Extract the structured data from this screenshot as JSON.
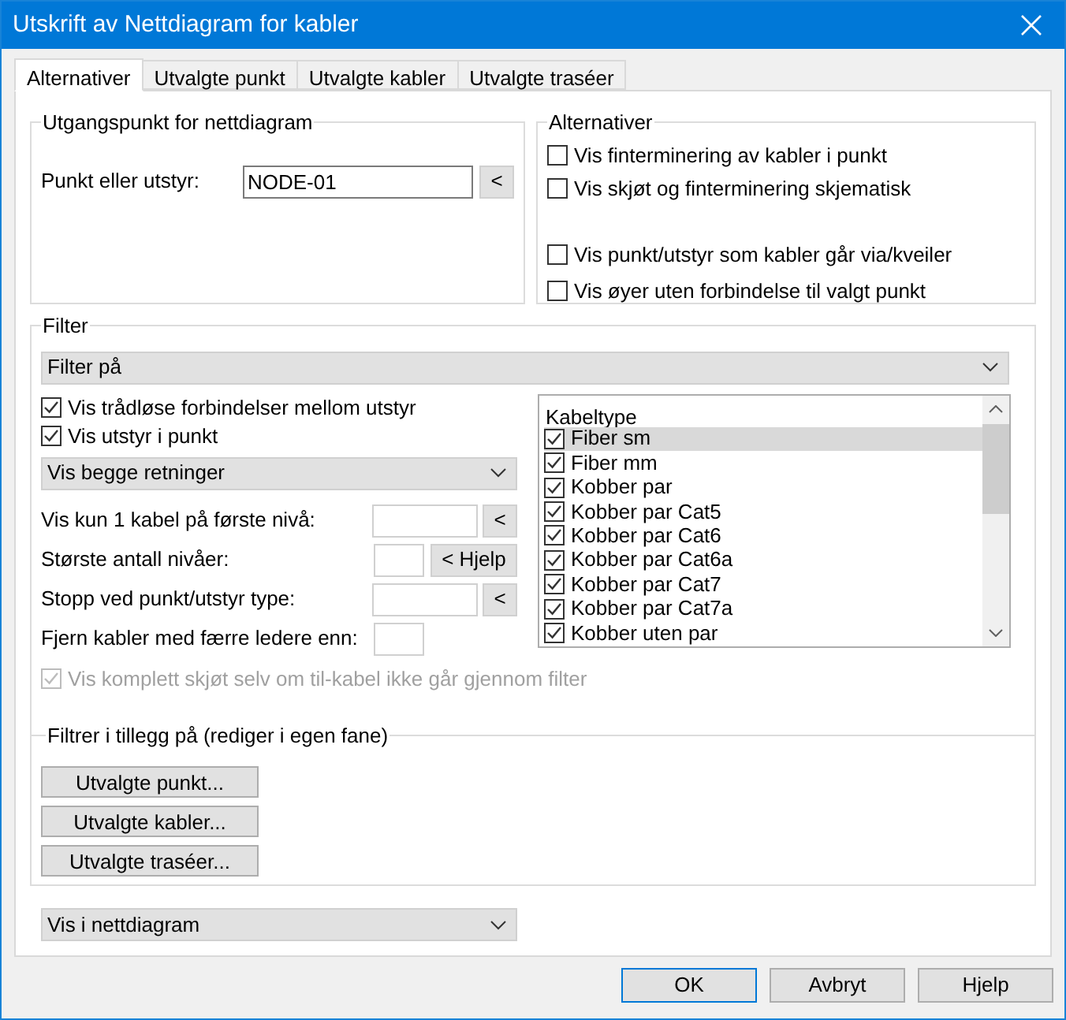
{
  "window": {
    "title": "Utskrift av Nettdiagram for kabler"
  },
  "tabs": [
    {
      "label": "Alternativer",
      "selected": true
    },
    {
      "label": "Utvalgte punkt",
      "selected": false
    },
    {
      "label": "Utvalgte kabler",
      "selected": false
    },
    {
      "label": "Utvalgte traséer",
      "selected": false
    }
  ],
  "start_group": {
    "title": "Utgangspunkt for nettdiagram",
    "field_label": "Punkt eller utstyr:",
    "field_value": "NODE-01",
    "pick_button": "<"
  },
  "alternatives_group": {
    "title": "Alternativer",
    "options_top": [
      {
        "label": "Vis finterminering av kabler i punkt",
        "checked": false
      },
      {
        "label": "Vis skjøt og finterminering skjematisk",
        "checked": false
      }
    ],
    "options_bottom": [
      {
        "label": "Vis punkt/utstyr som kabler går via/kveiler",
        "checked": false
      },
      {
        "label": "Vis øyer uten forbindelse til valgt punkt",
        "checked": false
      }
    ]
  },
  "filter": {
    "title": "Filter",
    "mode_dropdown": "Filter på",
    "checkboxes": [
      {
        "label": "Vis trådløse forbindelser mellom utstyr",
        "checked": true
      },
      {
        "label": "Vis utstyr i punkt",
        "checked": true
      }
    ],
    "direction_dropdown": "Vis begge retninger",
    "fields": [
      {
        "label": "Vis kun 1 kabel på første nivå:",
        "kind": "wide",
        "button": "<"
      },
      {
        "label": "Største antall nivåer:",
        "kind": "narrow",
        "button": "< Hjelp"
      },
      {
        "label": "Stopp ved punkt/utstyr type:",
        "kind": "wide",
        "button": "<"
      },
      {
        "label": "Fjern kabler med færre ledere enn:",
        "kind": "narrow"
      }
    ],
    "complete_splice": {
      "label": "Vis komplett skjøt selv om til-kabel ikke går gjennom filter",
      "checked": true,
      "disabled": true
    },
    "cable_types": {
      "header": "Kabeltype",
      "items": [
        {
          "label": "Fiber sm",
          "checked": true,
          "selected": true
        },
        {
          "label": "Fiber mm",
          "checked": true,
          "selected": false
        },
        {
          "label": "Kobber par",
          "checked": true,
          "selected": false
        },
        {
          "label": "Kobber par Cat5",
          "checked": true,
          "selected": false
        },
        {
          "label": "Kobber par Cat6",
          "checked": true,
          "selected": false
        },
        {
          "label": "Kobber par Cat6a",
          "checked": true,
          "selected": false
        },
        {
          "label": "Kobber par Cat7",
          "checked": true,
          "selected": false
        },
        {
          "label": "Kobber par Cat7a",
          "checked": true,
          "selected": false
        },
        {
          "label": "Kobber uten par",
          "checked": true,
          "selected": false
        }
      ]
    },
    "extra": {
      "title": "Filtrer i tillegg på (rediger i egen fane)",
      "buttons": [
        "Utvalgte punkt...",
        "Utvalgte kabler...",
        "Utvalgte traséer..."
      ]
    }
  },
  "view_dropdown": "Vis i nettdiagram",
  "buttons": [
    {
      "label": "OK",
      "default": true
    },
    {
      "label": "Avbryt",
      "default": false
    },
    {
      "label": "Hjelp",
      "default": false
    }
  ]
}
